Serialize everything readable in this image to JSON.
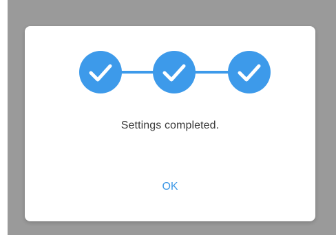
{
  "dialog": {
    "message": "Settings completed.",
    "ok_label": "OK"
  },
  "stepper": {
    "steps": [
      {
        "state": "completed",
        "icon": "check-icon"
      },
      {
        "state": "completed",
        "icon": "check-icon"
      },
      {
        "state": "completed",
        "icon": "check-icon"
      }
    ]
  },
  "colors": {
    "accent": "#3d9aea",
    "backdrop": "#9a9a9a",
    "dialog_bg": "#ffffff",
    "text": "#3a3a3a",
    "button_text": "#3d98e6"
  }
}
